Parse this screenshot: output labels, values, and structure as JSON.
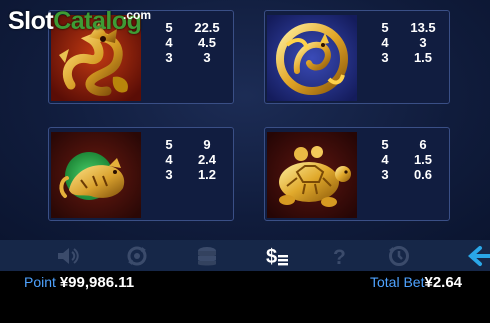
{
  "watermark": {
    "slot": "Slot",
    "catalog": "Catalog",
    "com": ".com"
  },
  "paytable": [
    {
      "symbol": "dragon-icon",
      "pays": [
        {
          "count": "5",
          "value": "22.5"
        },
        {
          "count": "4",
          "value": "4.5"
        },
        {
          "count": "3",
          "value": "3"
        }
      ]
    },
    {
      "symbol": "phoenix-icon",
      "pays": [
        {
          "count": "5",
          "value": "13.5"
        },
        {
          "count": "4",
          "value": "3"
        },
        {
          "count": "3",
          "value": "1.5"
        }
      ]
    },
    {
      "symbol": "tiger-icon",
      "pays": [
        {
          "count": "5",
          "value": "9"
        },
        {
          "count": "4",
          "value": "2.4"
        },
        {
          "count": "3",
          "value": "1.2"
        }
      ]
    },
    {
      "symbol": "turtle-icon",
      "pays": [
        {
          "count": "5",
          "value": "6"
        },
        {
          "count": "4",
          "value": "1.5"
        },
        {
          "count": "3",
          "value": "0.6"
        }
      ]
    }
  ],
  "toolbar": {
    "icons": [
      "sound-icon",
      "autoplay-icon",
      "bet-chips-icon",
      "paytable-icon",
      "help-icon",
      "history-icon",
      "back-arrow-icon"
    ],
    "active": "paytable-icon",
    "colors": {
      "inactive": "#3b4b6b",
      "active": "#ffffff",
      "back": "#2aa7e8"
    }
  },
  "footer": {
    "point_label": "Point",
    "point_value": "¥99,986.11",
    "total_bet_label": "Total Bet",
    "total_bet_value": "¥2.64"
  },
  "colors": {
    "label": "#4fa3ff",
    "card_border": "#3a4f86",
    "watermark_green": "#3e9c35"
  }
}
